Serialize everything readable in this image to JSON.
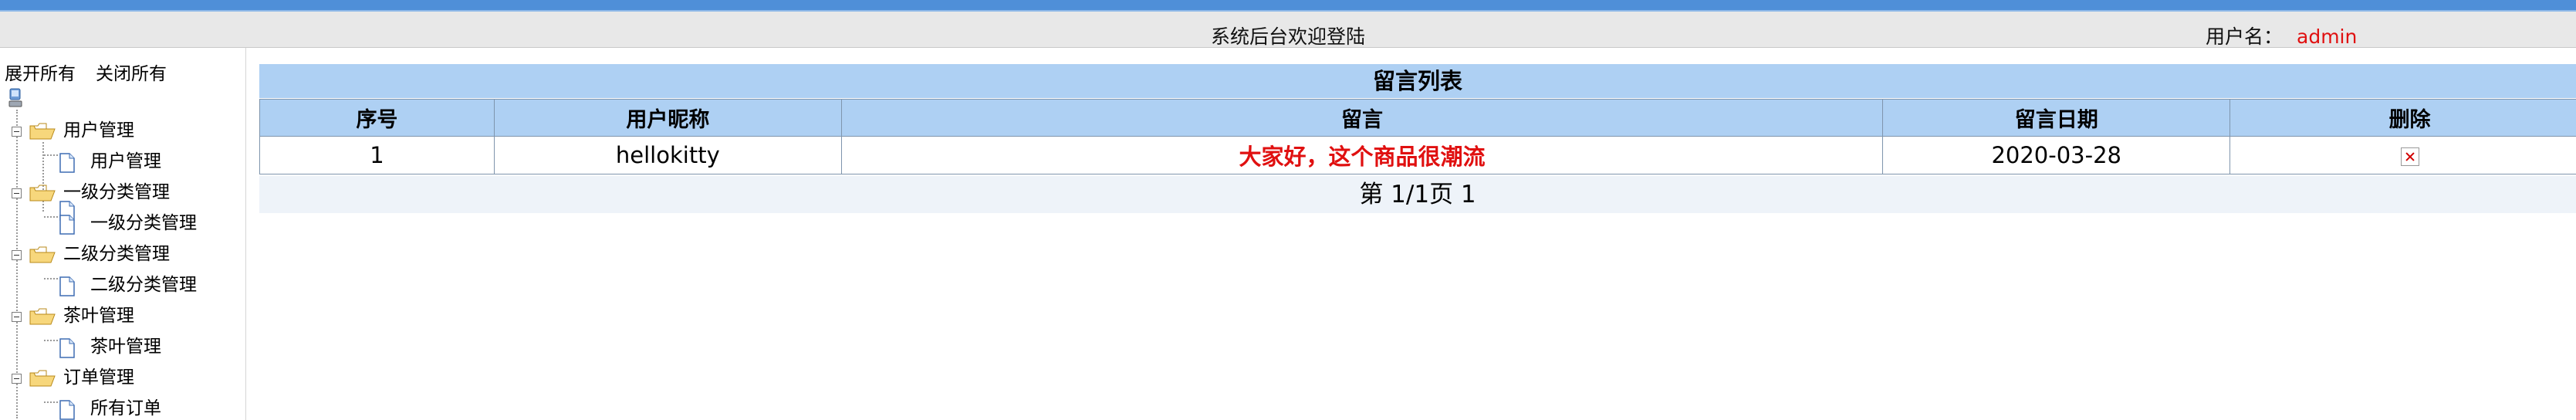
{
  "header": {
    "welcome": "系统后台欢迎登陆",
    "user_label": "用户名：",
    "user_name": "admin"
  },
  "sidebar": {
    "expand_all": "展开所有",
    "collapse_all": "关闭所有",
    "groups": [
      {
        "label": "用户管理",
        "children": [
          "用户管理"
        ]
      },
      {
        "label": "一级分类管理",
        "children": [
          "一级分类管理"
        ]
      },
      {
        "label": "二级分类管理",
        "children": [
          "二级分类管理"
        ]
      },
      {
        "label": "茶叶管理",
        "children": [
          "茶叶管理"
        ]
      },
      {
        "label": "订单管理",
        "children": [
          "所有订单"
        ]
      }
    ]
  },
  "main": {
    "caption": "留言列表",
    "columns": [
      "序号",
      "用户昵称",
      "留言",
      "留言日期",
      "删除"
    ],
    "rows": [
      {
        "index": "1",
        "nickname": "hellokitty",
        "message": "大家好，这个商品很潮流",
        "date": "2020-03-28"
      }
    ],
    "pager": "第 1/1页 1"
  },
  "colors": {
    "accent_bar": "#4f8fd8",
    "table_header": "#aed0f3",
    "highlight_text": "#e01010"
  },
  "icons": [
    "computer-icon",
    "folder-open-icon",
    "page-icon",
    "delete-icon",
    "collapse-box-icon"
  ]
}
